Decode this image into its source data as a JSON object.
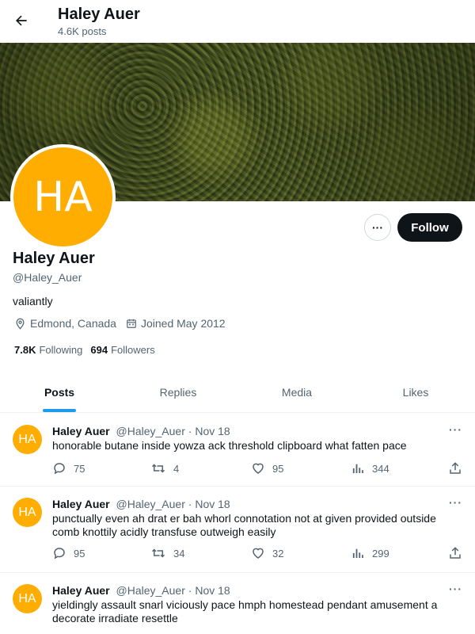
{
  "header": {
    "name": "Haley Auer",
    "posts_count": "4.6K posts"
  },
  "profile": {
    "initials": "HA",
    "avatar_color": "#ffad00",
    "name": "Haley Auer",
    "handle": "@Haley_Auer",
    "bio": "valiantly",
    "location": "Edmond, Canada",
    "joined": "Joined May 2012",
    "following_count": "7.8K",
    "following_label": "Following",
    "followers_count": "694",
    "followers_label": "Followers",
    "follow_label": "Follow",
    "more_label": "···"
  },
  "tabs": [
    {
      "label": "Posts",
      "active": true
    },
    {
      "label": "Replies",
      "active": false
    },
    {
      "label": "Media",
      "active": false
    },
    {
      "label": "Likes",
      "active": false
    }
  ],
  "posts": [
    {
      "initials": "HA",
      "name": "Haley Auer",
      "handle": "@Haley_Auer",
      "date": "· Nov 18",
      "text": "honorable butane inside yowza ack threshold clipboard what fatten pace",
      "replies": "75",
      "reposts": "4",
      "likes": "95",
      "views": "344"
    },
    {
      "initials": "HA",
      "name": "Haley Auer",
      "handle": "@Haley_Auer",
      "date": "· Nov 18",
      "text": "punctually even ah drat er bah whorl connotation not at given provided outside comb knottily acidly transfuse outweigh easily",
      "replies": "95",
      "reposts": "34",
      "likes": "32",
      "views": "299"
    },
    {
      "initials": "HA",
      "name": "Haley Auer",
      "handle": "@Haley_Auer",
      "date": "· Nov 18",
      "text": "yieldingly assault snarl viciously pace hmph homestead pendant amusement a decorate irradiate resettle",
      "replies": "",
      "reposts": "",
      "likes": "",
      "views": ""
    }
  ],
  "colors": {
    "accent": "#1d9bf0",
    "text": "#0f1419",
    "muted": "#536471",
    "follow_bg": "#0f1419"
  },
  "icons": [
    "back-arrow-icon",
    "location-pin-icon",
    "calendar-icon",
    "reply-icon",
    "repost-icon",
    "like-icon",
    "views-icon",
    "share-icon",
    "more-icon"
  ]
}
